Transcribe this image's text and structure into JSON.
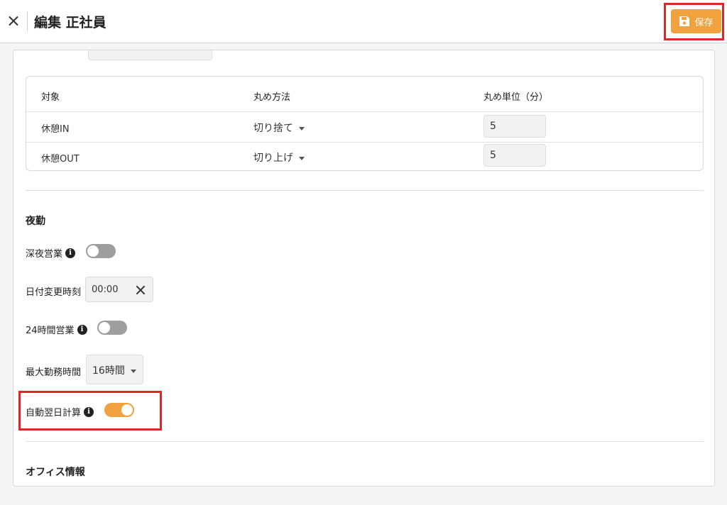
{
  "header": {
    "title": "編集 正社員",
    "save_label": "保存"
  },
  "rounding_table": {
    "columns": [
      "対象",
      "丸め方法",
      "丸め単位（分）"
    ],
    "rows": [
      {
        "target": "休憩IN",
        "method": "切り捨て",
        "unit": "5"
      },
      {
        "target": "休憩OUT",
        "method": "切り上げ",
        "unit": "5"
      }
    ]
  },
  "night": {
    "section_title": "夜勤",
    "late_night_label": "深夜営業",
    "late_night_on": false,
    "date_change_label": "日付変更時刻",
    "date_change_value": "00:00",
    "all_day_label": "24時間営業",
    "all_day_on": false,
    "max_hours_label": "最大勤務時間",
    "max_hours_value": "16時間",
    "auto_next_day_label": "自動翌日計算",
    "auto_next_day_on": true
  },
  "office": {
    "section_title": "オフィス情報"
  },
  "colors": {
    "accent": "#f0a23f",
    "highlight": "#e02626",
    "toggle_off": "#9e9e9e"
  }
}
